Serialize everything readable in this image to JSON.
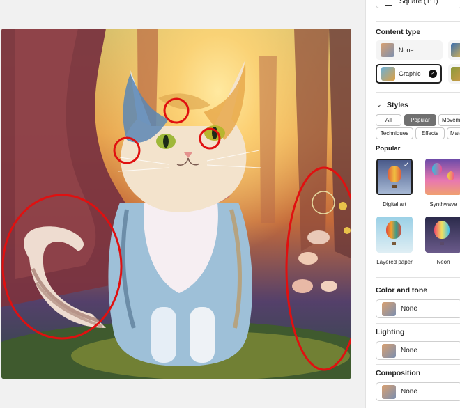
{
  "aspect_ratio": {
    "label": "Square (1:1)"
  },
  "content_type": {
    "title": "Content type",
    "options": [
      {
        "label": "None",
        "selected": false
      },
      {
        "label": "Graphic",
        "selected": true
      }
    ]
  },
  "styles": {
    "title": "Styles",
    "filters": [
      "All",
      "Popular",
      "Movem",
      "Techniques",
      "Effects",
      "Mate"
    ],
    "active_filter": "Popular",
    "popular_title": "Popular",
    "items": [
      {
        "label": "Digital art",
        "selected": true
      },
      {
        "label": "Synthwave",
        "selected": false
      },
      {
        "label": "Layered paper",
        "selected": false
      },
      {
        "label": "Neon",
        "selected": false
      }
    ]
  },
  "color_and_tone": {
    "title": "Color and tone",
    "value": "None"
  },
  "lighting": {
    "title": "Lighting",
    "value": "None"
  },
  "composition": {
    "title": "Composition",
    "value": "None"
  },
  "annotations": {
    "color": "#e01010",
    "count": 6
  }
}
